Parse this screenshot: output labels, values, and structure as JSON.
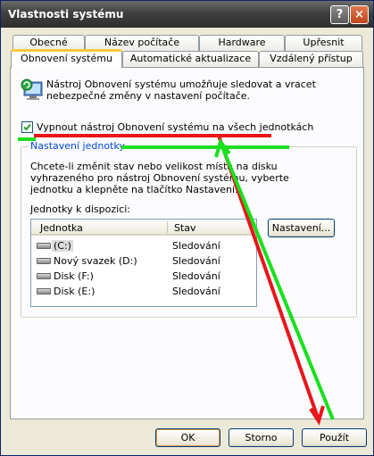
{
  "window": {
    "title": "Vlastnosti systému",
    "help_glyph": "?",
    "close_glyph": "×"
  },
  "tabs": {
    "row1": [
      "Obecné",
      "Název počítače",
      "Hardware",
      "Upřesnit"
    ],
    "row2": [
      "Obnovení systému",
      "Automatické aktualizace",
      "Vzdálený přístup"
    ],
    "active": "Obnovení systému"
  },
  "intro": "Nástroj Obnovení systému umožňuje sledovat a vracet nebezpečné změny v nastavení počítače.",
  "checkbox": {
    "label": "Vypnout nástroj Obnovení systému na všech jednotkách",
    "checked": true
  },
  "group": {
    "title": "Nastavení jednotky",
    "text": "Chcete-li změnit stav nebo velikost místa na disku vyhrazeného pro nástroj Obnovení systému, vyberte jednotku a klepněte na tlačítko Nastavení.",
    "available_label": "Jednotky k dispozici:",
    "columns": [
      "Jednotka",
      "Stav"
    ],
    "drives": [
      {
        "name": "(C:)",
        "status": "Sledování"
      },
      {
        "name": "Nový svazek (D:)",
        "status": "Sledování"
      },
      {
        "name": "Disk (F:)",
        "status": "Sledování"
      },
      {
        "name": "Disk (E:)",
        "status": "Sledování"
      }
    ],
    "settings_button": "Nastavení..."
  },
  "buttons": {
    "ok": "OK",
    "cancel": "Storno",
    "apply": "Použít"
  },
  "annotation_colors": {
    "red": "#e8161a",
    "green": "#19e01d"
  }
}
